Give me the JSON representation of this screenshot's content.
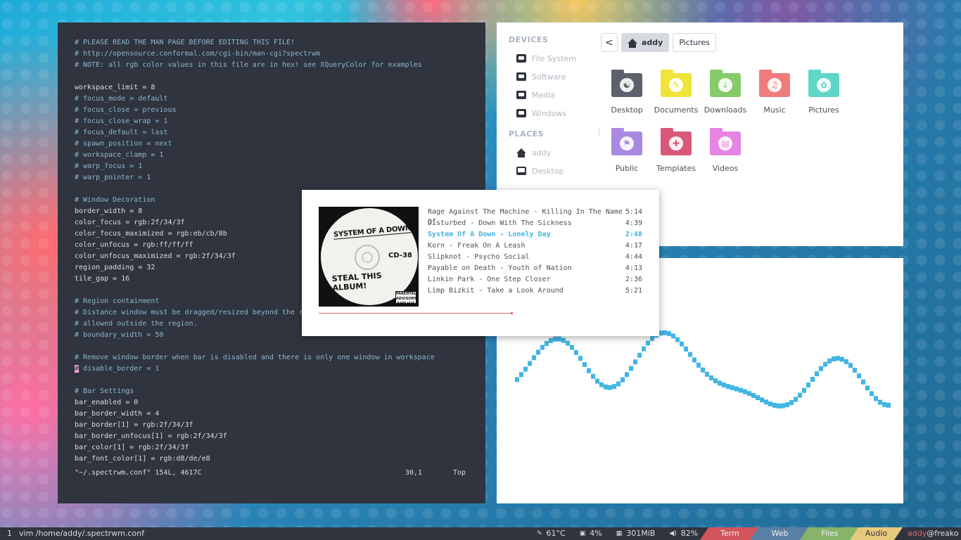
{
  "colors": {
    "accent": "#3fb4e2",
    "term_bg": "#2f343f",
    "term_fg": "#d8dee8",
    "progress": "#e0686e"
  },
  "terminal": {
    "lines": [
      {
        "t": "# PLEASE READ THE MAN PAGE BEFORE EDITING THIS FILE!",
        "c": true
      },
      {
        "t": "# http://opensource.conformal.com/cgi-bin/man-cgi?spectrwm",
        "c": true
      },
      {
        "t": "# NOTE: all rgb color values in this file are in hex! see XQueryColor for examples",
        "c": true
      },
      {
        "t": "",
        "c": false
      },
      {
        "t": "workspace_limit = 8",
        "c": false
      },
      {
        "t": "# focus_mode = default",
        "c": true
      },
      {
        "t": "# focus_close = previous",
        "c": true
      },
      {
        "t": "# focus_close_wrap = 1",
        "c": true
      },
      {
        "t": "# focus_default = last",
        "c": true
      },
      {
        "t": "# spawn_position = next",
        "c": true
      },
      {
        "t": "# workspace_clamp = 1",
        "c": true
      },
      {
        "t": "# warp_focus = 1",
        "c": true
      },
      {
        "t": "# warp_pointer = 1",
        "c": true
      },
      {
        "t": "",
        "c": false
      },
      {
        "t": "# Window Decoration",
        "c": true
      },
      {
        "t": "border_width = 8",
        "c": false
      },
      {
        "t": "color_focus = rgb:2f/34/3f",
        "c": false
      },
      {
        "t": "color_focus_maximized = rgb:eb/cb/8b",
        "c": false
      },
      {
        "t": "color_unfocus = rgb:ff/ff/ff",
        "c": false
      },
      {
        "t": "color_unfocus_maximized = rgb:2f/34/3f",
        "c": false
      },
      {
        "t": "region_padding = 32",
        "c": false
      },
      {
        "t": "tile_gap = 16",
        "c": false
      },
      {
        "t": "",
        "c": false
      },
      {
        "t": "# Region containment",
        "c": true
      },
      {
        "t": "# Distance window must be dragged/resized beyond the region edge",
        "c": true
      },
      {
        "t": "# allowed outside the region.",
        "c": true
      },
      {
        "t": "# boundary_width = 50",
        "c": true
      },
      {
        "t": "",
        "c": false
      },
      {
        "t": "# Remove window border when bar is disabled and there is only one window in workspace",
        "c": true
      },
      {
        "t": "CURSOR",
        "c": true
      },
      {
        "t": "",
        "c": false
      },
      {
        "t": "# Bar Settings",
        "c": true
      },
      {
        "t": "bar_enabled = 0",
        "c": false
      },
      {
        "t": "bar_border_width = 4",
        "c": false
      },
      {
        "t": "bar_border[1] = rgb:2f/34/3f",
        "c": false
      },
      {
        "t": "bar_border_unfocus[1] = rgb:2f/34/3f",
        "c": false
      },
      {
        "t": "bar_color[1] = rgb:2f/34/3f",
        "c": false
      },
      {
        "t": "bar_font_color[1] = rgb:d8/de/e8",
        "c": false
      }
    ],
    "cursor_line": {
      "cursor_char": "#",
      "rest": " disable_border = 1"
    },
    "status": {
      "file": "\"~/.spectrwm.conf\" 154L, 4617C",
      "pos": "30,1",
      "scroll": "Top"
    }
  },
  "file_manager": {
    "devices_heading": "DEVICES",
    "devices": [
      "File System",
      "Software",
      "Media",
      "Windows"
    ],
    "places_heading": "PLACES",
    "places": [
      {
        "label": "addy",
        "icon": "home-icon"
      },
      {
        "label": "Desktop",
        "icon": "monitor-icon"
      }
    ],
    "back_label": "<",
    "path": [
      "addy",
      "Pictures"
    ],
    "folders": [
      {
        "label": "Desktop",
        "color": "#5c616c",
        "glyph": "☯",
        "icon": "desktop-folder-icon"
      },
      {
        "label": "Documents",
        "color": "#f0e43b",
        "glyph": "✎",
        "icon": "documents-folder-icon"
      },
      {
        "label": "Downloads",
        "color": "#86cb6a",
        "glyph": "↓",
        "icon": "downloads-folder-icon"
      },
      {
        "label": "Music",
        "color": "#f07b7b",
        "glyph": "♫",
        "icon": "music-folder-icon"
      },
      {
        "label": "Pictures",
        "color": "#5fd6c8",
        "glyph": "✿",
        "icon": "pictures-folder-icon"
      },
      {
        "label": "Public",
        "color": "#a989e2",
        "glyph": "⚑",
        "icon": "public-folder-icon"
      },
      {
        "label": "Templates",
        "color": "#d9587a",
        "glyph": "✚",
        "icon": "templates-folder-icon"
      },
      {
        "label": "Videos",
        "color": "#e584e2",
        "glyph": "▤",
        "icon": "videos-folder-icon"
      }
    ]
  },
  "music": {
    "album": {
      "line1": "SYSTEM OF A DOWN",
      "cd": "CD-38",
      "line2": "STEAL THIS ALBUM!",
      "advisory": "PARENTAL ADVISORY EXPLICIT CONTENT"
    },
    "tracks": [
      {
        "title": "Rage Against The Machine - Killing In The Name Of",
        "time": "5:14",
        "active": false
      },
      {
        "title": "Disturbed - Down With The Sickness",
        "time": "4:39",
        "active": false
      },
      {
        "title": "System Of A Down - Lonely Day",
        "time": "2:48",
        "active": true
      },
      {
        "title": "Korn - Freak On A Leash",
        "time": "4:17",
        "active": false
      },
      {
        "title": "Slipknot - Psycho Social",
        "time": "4:44",
        "active": false
      },
      {
        "title": "Payable on Death - Youth of Nation",
        "time": "4:13",
        "active": false
      },
      {
        "title": "Linkin Park - One Step Closer",
        "time": "2:36",
        "active": false
      },
      {
        "title": "Limp Bizkit - Take a Look Around",
        "time": "5:21",
        "active": false
      }
    ],
    "progress": 0.55
  },
  "panel": {
    "workspace": "1",
    "window_title": "vim /home/addy/.spectrwm.conf",
    "temp": "61°C",
    "cpu": "4%",
    "mem": "301MiB",
    "volume": "82%",
    "tags": [
      "Term",
      "Web",
      "Files",
      "Audio"
    ],
    "user": "addy",
    "host": "@freako"
  }
}
